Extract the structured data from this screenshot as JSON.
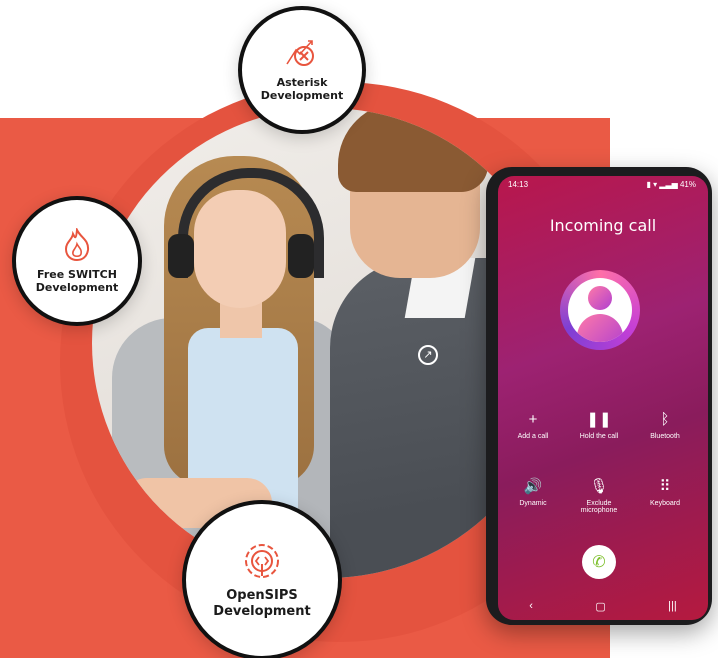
{
  "badges": {
    "asterisk": {
      "title_line1": "Asterisk",
      "title_line2": "Development",
      "icon": "gear-cross-icon"
    },
    "freeswitch": {
      "title_line1": "Free SWITCH",
      "title_line2": "Development",
      "icon": "flame-icon"
    },
    "opensips": {
      "title_line1": "OpenSIPS",
      "title_line2": "Development",
      "icon": "code-gear-icon"
    }
  },
  "phone": {
    "status_time": "14:13",
    "status_right": "41%",
    "call_title": "Incoming call",
    "controls": [
      {
        "label": "Add a call",
        "icon": "+"
      },
      {
        "label": "Hold the call",
        "icon": "❚❚"
      },
      {
        "label": "Bluetooth",
        "icon": "ᛒ"
      },
      {
        "label": "Dynamic",
        "icon": "🔊"
      },
      {
        "label_line1": "Exclude",
        "label_line2": "microphone",
        "icon": "🎙"
      },
      {
        "label": "Keyboard",
        "icon": "⠿"
      }
    ],
    "nav": {
      "back": "‹",
      "home": "▢",
      "recents": "|||"
    }
  },
  "colors": {
    "accent": "#ea5a45",
    "phone_screen": "#a81c5a",
    "icon_orange": "#e8553e"
  }
}
